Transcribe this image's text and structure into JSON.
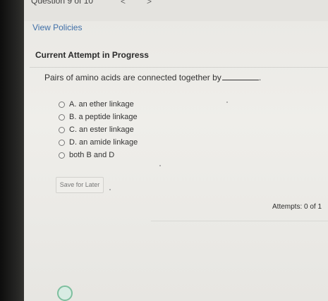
{
  "header": {
    "question_counter": "Question 9 of 10",
    "prev_glyph": "<",
    "next_glyph": ">"
  },
  "links": {
    "view_policies": "View Policies"
  },
  "attempt": {
    "title": "Current Attempt in Progress"
  },
  "question": {
    "prompt": "Pairs of amino acids are connected together by",
    "suffix": "."
  },
  "options": [
    {
      "label": "A. an ether linkage"
    },
    {
      "label": "B. a peptide linkage"
    },
    {
      "label": "C. an ester linkage"
    },
    {
      "label": "D. an amide linkage"
    },
    {
      "label": "both B and D"
    }
  ],
  "buttons": {
    "save_for_later": "Save for Later"
  },
  "status": {
    "attempts": "Attempts: 0 of 1"
  },
  "icons": {
    "assistant": "assistant-bot-icon"
  },
  "colors": {
    "link": "#3f6fa8",
    "assistant_accent": "#7dbf9e"
  }
}
